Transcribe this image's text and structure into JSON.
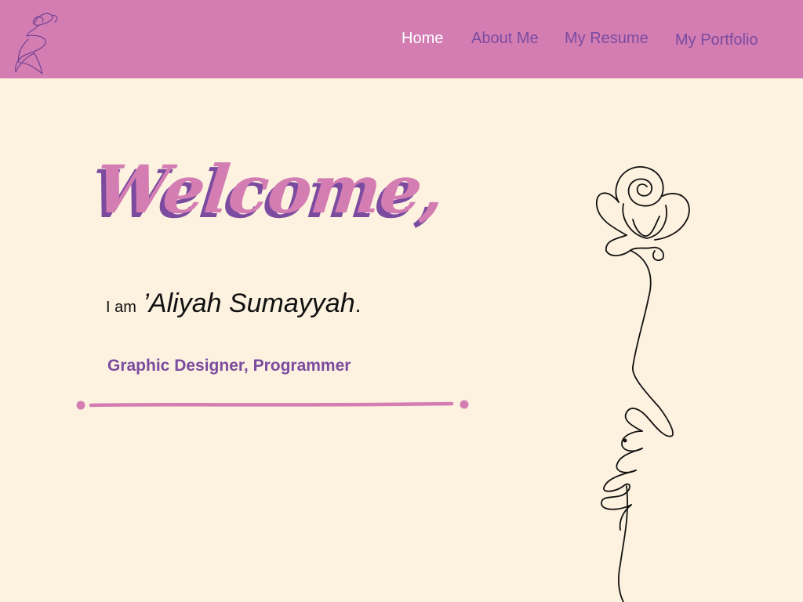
{
  "header": {
    "bg_color": "#d37db3",
    "logo_icon": "line-art-butterfly-figure-logo"
  },
  "nav": {
    "items": [
      {
        "label": "Home",
        "active": true
      },
      {
        "label": "About Me",
        "active": false
      },
      {
        "label": "My Resume",
        "active": false
      },
      {
        "label": "My Portfolio",
        "active": false
      }
    ]
  },
  "hero": {
    "greeting": "Welcome,",
    "intro_prefix": "I am",
    "name": "’Aliyah Sumayyah",
    "name_suffix": ".",
    "subtitle": "Graphic Designer, Programmer",
    "illustration": "line-art-rose-with-signature"
  },
  "colors": {
    "page_bg": "#fdf2df",
    "accent_pink": "#d37db3",
    "accent_purple": "#7b4ba0",
    "text_dark": "#111111"
  }
}
